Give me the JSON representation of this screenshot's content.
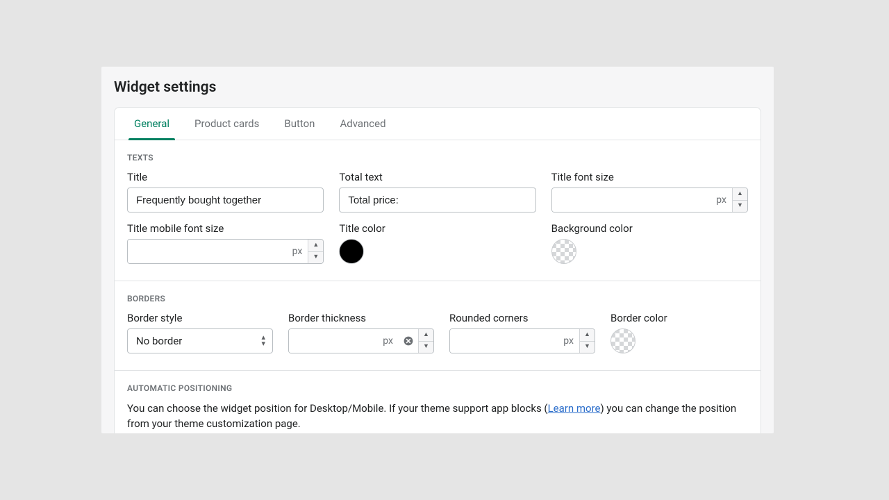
{
  "page_title": "Widget settings",
  "tabs": [
    "General",
    "Product cards",
    "Button",
    "Advanced"
  ],
  "active_tab_index": 0,
  "texts_section": {
    "heading": "TEXTS",
    "title": {
      "label": "Title",
      "value": "Frequently bought together"
    },
    "total_text": {
      "label": "Total text",
      "value": "Total price:"
    },
    "title_font_size": {
      "label": "Title font size",
      "value": "",
      "unit": "px"
    },
    "title_mobile_font_size": {
      "label": "Title mobile font size",
      "value": "",
      "unit": "px"
    },
    "title_color": {
      "label": "Title color",
      "value": "#000000"
    },
    "background_color": {
      "label": "Background color",
      "value": "transparent"
    }
  },
  "borders_section": {
    "heading": "BORDERS",
    "border_style": {
      "label": "Border style",
      "value": "No border"
    },
    "border_thickness": {
      "label": "Border thickness",
      "value": "",
      "unit": "px"
    },
    "rounded_corners": {
      "label": "Rounded corners",
      "value": "",
      "unit": "px"
    },
    "border_color": {
      "label": "Border color",
      "value": "transparent"
    }
  },
  "positioning_section": {
    "heading": "AUTOMATIC POSITIONING",
    "text_before": "You can choose the widget position for Desktop/Mobile. If your theme support app blocks (",
    "link_text": "Learn more",
    "text_after": ") you can change the position from your theme customization page."
  }
}
